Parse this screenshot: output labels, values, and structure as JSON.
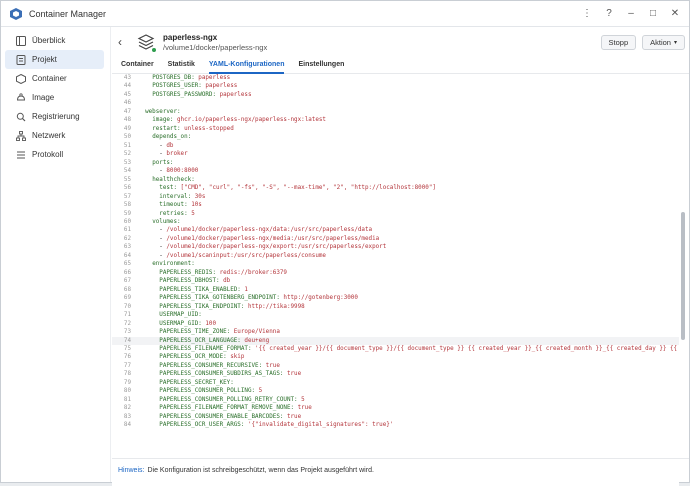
{
  "app": {
    "title": "Container Manager"
  },
  "window_controls": [
    "⋮",
    "?",
    "–",
    "□",
    "✕"
  ],
  "sidebar": {
    "items": [
      {
        "label": "Überblick",
        "icon": "overview-icon",
        "active": false
      },
      {
        "label": "Projekt",
        "icon": "project-icon",
        "active": true
      },
      {
        "label": "Container",
        "icon": "container-icon",
        "active": false
      },
      {
        "label": "Image",
        "icon": "image-icon",
        "active": false
      },
      {
        "label": "Registrierung",
        "icon": "registry-icon",
        "active": false
      },
      {
        "label": "Netzwerk",
        "icon": "network-icon",
        "active": false
      },
      {
        "label": "Protokoll",
        "icon": "log-icon",
        "active": false
      }
    ]
  },
  "header": {
    "project_name": "paperless-ngx",
    "project_path": "/volume1/docker/paperless-ngx",
    "stop_label": "Stopp",
    "action_label": "Aktion",
    "action_arrow": "▾"
  },
  "tabs": [
    {
      "label": "Container",
      "active": false
    },
    {
      "label": "Statistik",
      "active": false
    },
    {
      "label": "YAML-Konfigurationen",
      "active": true
    },
    {
      "label": "Einstellungen",
      "active": false
    }
  ],
  "editor": {
    "lines": [
      {
        "n": "43",
        "text": "    POSTGRES_DB: paperless"
      },
      {
        "n": "44",
        "text": "    POSTGRES_USER: paperless"
      },
      {
        "n": "45",
        "text": "    POSTGRES_PASSWORD: paperless"
      },
      {
        "n": "46",
        "text": ""
      },
      {
        "n": "47",
        "text": "  webserver:"
      },
      {
        "n": "48",
        "text": "    image: ghcr.io/paperless-ngx/paperless-ngx:latest"
      },
      {
        "n": "49",
        "text": "    restart: unless-stopped"
      },
      {
        "n": "50",
        "text": "    depends_on:"
      },
      {
        "n": "51",
        "text": "      - db"
      },
      {
        "n": "52",
        "text": "      - broker"
      },
      {
        "n": "53",
        "text": "    ports:"
      },
      {
        "n": "54",
        "text": "      - 8000:8000"
      },
      {
        "n": "55",
        "text": "    healthcheck:"
      },
      {
        "n": "56",
        "text": "      test: [\"CMD\", \"curl\", \"-fs\", \"-S\", \"--max-time\", \"2\", \"http://localhost:8000\"]"
      },
      {
        "n": "57",
        "text": "      interval: 30s"
      },
      {
        "n": "58",
        "text": "      timeout: 10s"
      },
      {
        "n": "59",
        "text": "      retries: 5"
      },
      {
        "n": "60",
        "text": "    volumes:"
      },
      {
        "n": "61",
        "text": "      - /volume1/docker/paperless-ngx/data:/usr/src/paperless/data"
      },
      {
        "n": "62",
        "text": "      - /volume1/docker/paperless-ngx/media:/usr/src/paperless/media"
      },
      {
        "n": "63",
        "text": "      - /volume1/docker/paperless-ngx/export:/usr/src/paperless/export"
      },
      {
        "n": "64",
        "text": "      - /volume1/scaninput:/usr/src/paperless/consume"
      },
      {
        "n": "65",
        "text": "    environment:"
      },
      {
        "n": "66",
        "text": "      PAPERLESS_REDIS: redis://broker:6379"
      },
      {
        "n": "67",
        "text": "      PAPERLESS_DBHOST: db"
      },
      {
        "n": "68",
        "text": "      PAPERLESS_TIKA_ENABLED: 1"
      },
      {
        "n": "69",
        "text": "      PAPERLESS_TIKA_GOTENBERG_ENDPOINT: http://gotenberg:3000"
      },
      {
        "n": "70",
        "text": "      PAPERLESS_TIKA_ENDPOINT: http://tika:9998"
      },
      {
        "n": "71",
        "text": "      USERMAP_UID:"
      },
      {
        "n": "72",
        "text": "      USERMAP_GID: 100"
      },
      {
        "n": "73",
        "text": "      PAPERLESS_TIME_ZONE: Europe/Vienna"
      },
      {
        "n": "74",
        "text": "      PAPERLESS_OCR_LANGUAGE: deu+eng"
      },
      {
        "n": "75",
        "text": "      PAPERLESS_FILENAME_FORMAT: '{{ created_year }}/{{ document_type }}/{{ document_type }} {{ created_year }}_{{ created_month }}_{{ created_day }} {{ correspondent"
      },
      {
        "n": "76",
        "text": "      PAPERLESS_OCR_MODE: skip"
      },
      {
        "n": "77",
        "text": "      PAPERLESS_CONSUMER_RECURSIVE: true"
      },
      {
        "n": "78",
        "text": "      PAPERLESS_CONSUMER_SUBDIRS_AS_TAGS: true"
      },
      {
        "n": "79",
        "text": "      PAPERLESS_SECRET_KEY:"
      },
      {
        "n": "80",
        "text": "      PAPERLESS_CONSUMER_POLLING: 5"
      },
      {
        "n": "81",
        "text": "      PAPERLESS_CONSUMER_POLLING_RETRY_COUNT: 5"
      },
      {
        "n": "82",
        "text": "      PAPERLESS_FILENAME_FORMAT_REMOVE_NONE: true"
      },
      {
        "n": "83",
        "text": "      PAPERLESS_CONSUMER_ENABLE_BARCODES: true"
      },
      {
        "n": "84",
        "text": "      PAPERLESS_OCR_USER_ARGS: '{\"invalidate_digital_signatures\": true}'"
      }
    ],
    "highlighted_line": "74"
  },
  "footer": {
    "hint_label": "Hinweis:",
    "hint_text": "Die Konfiguration ist schreibgeschützt, wenn das Projekt ausgeführt wird."
  },
  "colors": {
    "accent": "#1c66c4",
    "status_running": "#2e9d4e"
  }
}
